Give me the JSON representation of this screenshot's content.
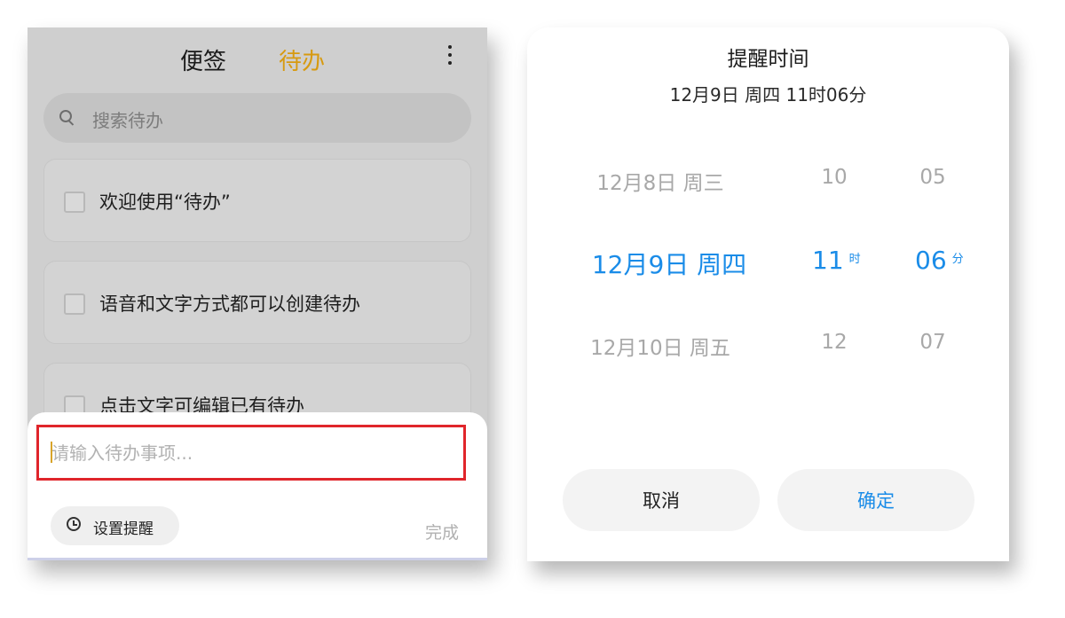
{
  "left": {
    "tabs": {
      "notes": "便签",
      "todo": "待办"
    },
    "search_placeholder": "搜索待办",
    "todos": [
      "欢迎使用“待办”",
      "语音和文字方式都可以创建待办",
      "点击文字可编辑已有待办"
    ],
    "input_placeholder": "请输入待办事项...",
    "set_reminder_label": "设置提醒",
    "done_label": "完成",
    "accent": "#d79a10",
    "highlight": "#e0252b"
  },
  "right": {
    "title": "提醒时间",
    "subtitle": "12月9日 周四 11时06分",
    "date_col": {
      "prev": "12月8日 周三",
      "selected": "12月9日 周四",
      "next": "12月10日 周五"
    },
    "hour_col": {
      "prev": "10",
      "selected": "11",
      "next": "12",
      "unit": "时"
    },
    "minute_col": {
      "prev": "05",
      "selected": "06",
      "next": "07",
      "unit": "分"
    },
    "cancel_label": "取消",
    "confirm_label": "确定",
    "accent": "#1a8ce8"
  }
}
